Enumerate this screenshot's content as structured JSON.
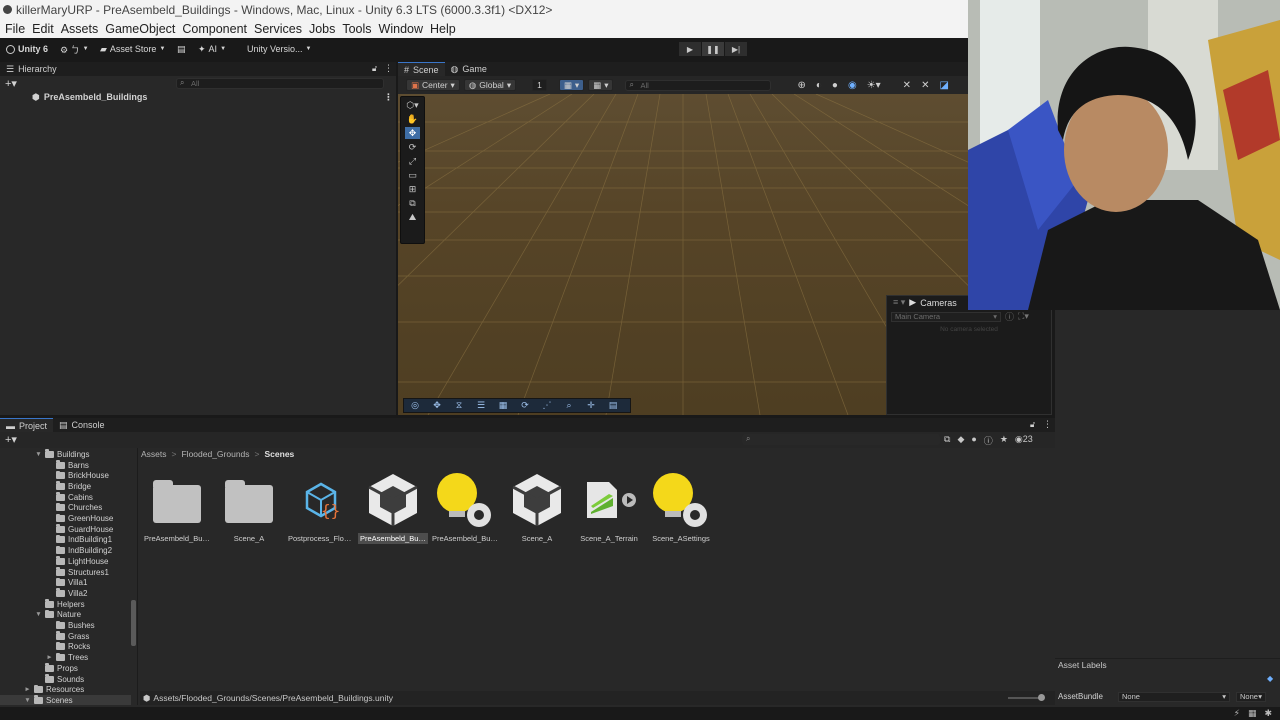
{
  "title": "killerMaryURP - PreAsembeld_Buildings - Windows, Mac, Linux - Unity 6.3 LTS (6000.3.3f1) <DX12>",
  "menu": [
    "File",
    "Edit",
    "Assets",
    "GameObject",
    "Component",
    "Services",
    "Jobs",
    "Tools",
    "Window",
    "Help"
  ],
  "toolbar": {
    "account": "Unity 6",
    "cloud": "⚙ ㄅ",
    "asset_store": "Asset Store",
    "ai": "AI",
    "version_control": "Unity Versio..."
  },
  "hierarchy": {
    "tab": "Hierarchy",
    "search_placeholder": "All",
    "root": "PreAsembeld_Buildings"
  },
  "scene": {
    "tabs": [
      "Scene",
      "Game"
    ],
    "pivot": "Center",
    "space": "Global",
    "grid_snap": "1",
    "search_placeholder": "All"
  },
  "cameras": {
    "title": "Cameras",
    "camera": "Main Camera",
    "info": "No camera selected"
  },
  "project": {
    "tabs": [
      "Project",
      "Console"
    ],
    "count": "23",
    "breadcrumb": [
      "Assets",
      "Flooded_Grounds",
      "Scenes"
    ],
    "tree": [
      {
        "label": "Buildings",
        "indent": 1,
        "arrow": "▼"
      },
      {
        "label": "Barns",
        "indent": 2
      },
      {
        "label": "BrickHouse",
        "indent": 2
      },
      {
        "label": "Bridge",
        "indent": 2
      },
      {
        "label": "Cabins",
        "indent": 2
      },
      {
        "label": "Churches",
        "indent": 2
      },
      {
        "label": "GreenHouse",
        "indent": 2
      },
      {
        "label": "GuardHouse",
        "indent": 2
      },
      {
        "label": "IndBuilding1",
        "indent": 2
      },
      {
        "label": "IndBuilding2",
        "indent": 2
      },
      {
        "label": "LightHouse",
        "indent": 2
      },
      {
        "label": "Structures1",
        "indent": 2
      },
      {
        "label": "Villa1",
        "indent": 2
      },
      {
        "label": "Villa2",
        "indent": 2
      },
      {
        "label": "Helpers",
        "indent": 1
      },
      {
        "label": "Nature",
        "indent": 1,
        "arrow": "▼"
      },
      {
        "label": "Bushes",
        "indent": 2
      },
      {
        "label": "Grass",
        "indent": 2
      },
      {
        "label": "Rocks",
        "indent": 2
      },
      {
        "label": "Trees",
        "indent": 2,
        "arrow": "►"
      },
      {
        "label": "Props",
        "indent": 1
      },
      {
        "label": "Sounds",
        "indent": 1
      },
      {
        "label": "Resources",
        "indent": 0,
        "arrow": "►"
      },
      {
        "label": "Scenes",
        "indent": 0,
        "arrow": "▼"
      }
    ],
    "assets": [
      {
        "label": "PreAsembeld_Buil...",
        "icon": "folder-icon"
      },
      {
        "label": "Scene_A",
        "icon": "folder-icon"
      },
      {
        "label": "Postprocess_Floo...",
        "icon": "volume-profile-icon"
      },
      {
        "label": "PreAsembeld_Buil...",
        "icon": "unity-scene-icon",
        "selected": true
      },
      {
        "label": "PreAsembeld_Buil...",
        "icon": "lighting-settings-icon"
      },
      {
        "label": "Scene_A",
        "icon": "unity-scene-icon"
      },
      {
        "label": "Scene_A_Terrain",
        "icon": "terrain-data-icon"
      },
      {
        "label": "Scene_ASettings",
        "icon": "lighting-settings-icon"
      }
    ],
    "path": "Assets/Flooded_Grounds/Scenes/PreAsembeld_Buildings.unity"
  },
  "inspector": {
    "asset_labels": "Asset Labels",
    "asset_bundle_label": "AssetBundle",
    "bundle_value": "None",
    "variant_value": "None"
  }
}
